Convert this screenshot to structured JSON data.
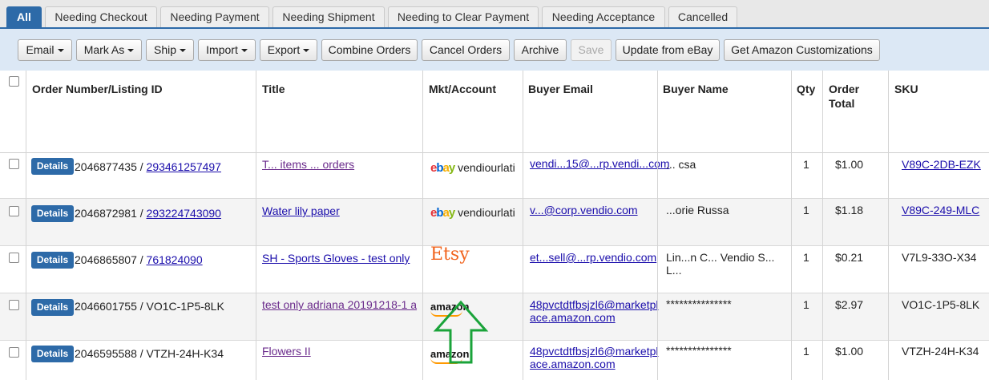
{
  "tabs": [
    "All",
    "Needing Checkout",
    "Needing Payment",
    "Needing Shipment",
    "Needing to Clear Payment",
    "Needing Acceptance",
    "Cancelled"
  ],
  "toolbar": [
    "Email",
    "Mark As",
    "Ship",
    "Import",
    "Export",
    "Combine Orders",
    "Cancel Orders",
    "Archive",
    "Save",
    "Update from eBay",
    "Get Amazon Customizations"
  ],
  "columns": [
    "Order Number/Listing ID",
    "Title",
    "Mkt/Account",
    "Buyer Email",
    "Buyer Name",
    "Qty",
    "Order Total",
    "SKU"
  ],
  "details_label": "Details",
  "rows": [
    {
      "order": "2046877435 / ",
      "listing": "293461257497",
      "title": "T... items ... orders",
      "market": "eBay",
      "account": "vendiourlati",
      "email": "vendi...15@...rp.vendi...com",
      "name": "... csa",
      "qty": "1",
      "total": "$1.00",
      "sku": "V89C-2DB-EZK"
    },
    {
      "order": "2046872981 / ",
      "listing": "293224743090",
      "title": "Water lily paper",
      "market": "eBay",
      "account": "vendiourlati",
      "email": "v...@corp.vendio.com",
      "name": "...orie Russa",
      "qty": "1",
      "total": "$1.18",
      "sku": "V89C-249-MLC"
    },
    {
      "order": "2046865807 / ",
      "listing": "761824090",
      "title": "SH - Sports Gloves - test only",
      "market": "Etsy",
      "account": "",
      "email": "et...sell@...rp.vendio.com",
      "name": "Lin...n C... Vendio S... L...",
      "qty": "1",
      "total": "$0.21",
      "sku": "V7L9-33O-X34"
    },
    {
      "order": "2046601755 / VO1C-1P5-8LK",
      "listing": "",
      "title": "test only adriana 20191218-1 a",
      "market": "amazon",
      "account": "",
      "email": "48pvctdtfbsjzl6@marketplace.amazon.com",
      "name": "***************",
      "qty": "1",
      "total": "$2.97",
      "sku": "VO1C-1P5-8LK"
    },
    {
      "order": "2046595588 / VTZH-24H-K34",
      "listing": "",
      "title": "Flowers II",
      "market": "amazon",
      "account": "",
      "email": "48pvctdtfbsjzl6@marketplace.amazon.com",
      "name": "***************",
      "qty": "1",
      "total": "$1.00",
      "sku": "VTZH-24H-K34"
    }
  ],
  "colors": {
    "accent": "#2d6aa8",
    "toolbar_bg": "#dce8f5",
    "arrow": "#1aa33a"
  }
}
